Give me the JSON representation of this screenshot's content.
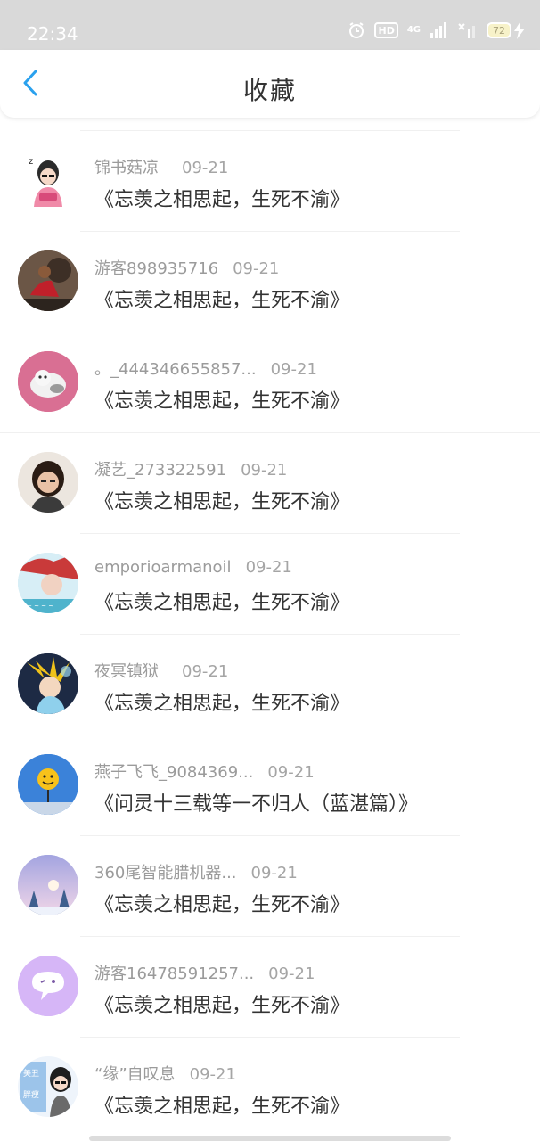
{
  "status_bar": {
    "time": "22:34",
    "icons": {
      "alarm": "alarm-clock-icon",
      "hd": "HD",
      "network": "4G",
      "battery": "72"
    }
  },
  "header": {
    "title": "收藏",
    "back_icon": "chevron-left-icon",
    "accent_color": "#2aa1ee"
  },
  "items": [
    {
      "username": "锦书菇凉",
      "date": "09-21",
      "book": "《忘羡之相思起，生死不渝》"
    },
    {
      "username": "游客898935716",
      "date": "09-21",
      "book": "《忘羡之相思起，生死不渝》"
    },
    {
      "username": "。_444346655857...",
      "date": "09-21",
      "book": "《忘羡之相思起，生死不渝》"
    },
    {
      "username": "凝艺_273322591",
      "date": "09-21",
      "book": "《忘羡之相思起，生死不渝》"
    },
    {
      "username": "emporioarmanoil",
      "date": "09-21",
      "book": "《忘羡之相思起，生死不渝》"
    },
    {
      "username": "夜冥镇狱",
      "date": "09-21",
      "book": "《忘羡之相思起，生死不渝》"
    },
    {
      "username": "燕子飞飞_9084369...",
      "date": "09-21",
      "book": "《问灵十三载等一不归人（蓝湛篇）》"
    },
    {
      "username": "360尾智能腊机器...",
      "date": "09-21",
      "book": "《忘羡之相思起，生死不渝》"
    },
    {
      "username": "游客16478591257...",
      "date": "09-21",
      "book": "《忘羡之相思起，生死不渝》"
    },
    {
      "username": "“缘”自叹息",
      "date": "09-21",
      "book": "《忘羡之相思起，生死不渝》"
    }
  ]
}
